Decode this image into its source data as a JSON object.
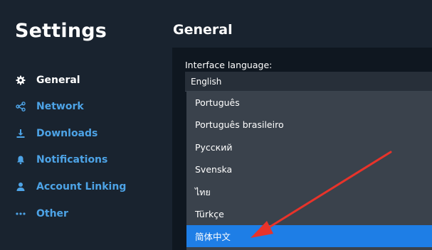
{
  "sidebar": {
    "title": "Settings",
    "items": [
      {
        "label": "General",
        "icon": "gear-icon",
        "active": true
      },
      {
        "label": "Network",
        "icon": "network-icon",
        "active": false
      },
      {
        "label": "Downloads",
        "icon": "download-icon",
        "active": false
      },
      {
        "label": "Notifications",
        "icon": "bell-icon",
        "active": false
      },
      {
        "label": "Account Linking",
        "icon": "person-icon",
        "active": false
      },
      {
        "label": "Other",
        "icon": "more-dots-icon",
        "active": false
      }
    ]
  },
  "main": {
    "title": "General",
    "language": {
      "label": "Interface language:",
      "selected": "English",
      "options": [
        {
          "label": "Português",
          "highlighted": false
        },
        {
          "label": "Português brasileiro",
          "highlighted": false
        },
        {
          "label": "Русский",
          "highlighted": false
        },
        {
          "label": "Svenska",
          "highlighted": false
        },
        {
          "label": "ไทย",
          "highlighted": false
        },
        {
          "label": "Türkçe",
          "highlighted": false
        },
        {
          "label": "简体中文",
          "highlighted": true
        }
      ]
    }
  },
  "colors": {
    "background": "#19232f",
    "panel": "#0f1720",
    "accent_link": "#4da3e6",
    "dropdown": "#3a424c",
    "highlight": "#1e7ee6",
    "annotation_arrow": "#e8332a"
  }
}
